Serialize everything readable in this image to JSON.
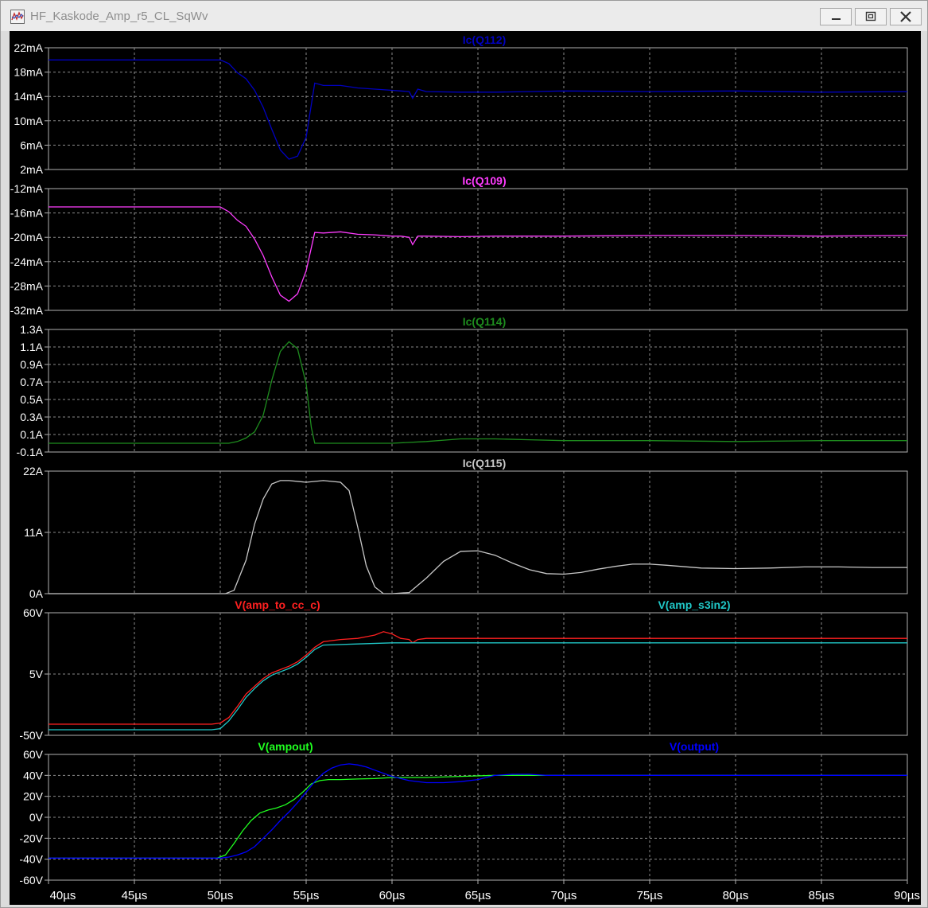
{
  "window": {
    "title": "HF_Kaskode_Amp_r5_CL_SqWv",
    "icons": [
      "waveform-app-icon",
      "minimize-icon",
      "maximize-icon",
      "close-icon"
    ]
  },
  "colors": {
    "background": "#000000",
    "grid": "#8a8a8a",
    "axis_text": "#ffffff",
    "Ic(Q112)": "#0000c0",
    "Ic(Q109)": "#ff3cff",
    "Ic(Q114)": "#1e8c1e",
    "Ic(Q115)": "#c8c8c8",
    "V(amp_to_cc_c)": "#ff2020",
    "V(amp_s3in2)": "#20c8c8",
    "V(ampout)": "#20ff20",
    "V(output)": "#0000ff"
  },
  "chart_data": [
    {
      "type": "line",
      "series": [
        {
          "name": "Ic(Q112)",
          "x": [
            40,
            50,
            50.5,
            51,
            51.5,
            52,
            52.5,
            53,
            53.5,
            54,
            54.5,
            55,
            55.5,
            56,
            57,
            58,
            59,
            60,
            60.5,
            61,
            61.2,
            61.5,
            62,
            64,
            66,
            68,
            70,
            75,
            80,
            85,
            90
          ],
          "y": [
            20,
            20,
            19.4,
            17.9,
            16.9,
            15,
            12.2,
            8.6,
            5.2,
            3.7,
            4.2,
            7.3,
            16.2,
            15.8,
            15.8,
            15.4,
            15.2,
            15,
            14.9,
            14.8,
            13.7,
            15.2,
            14.8,
            14.7,
            14.7,
            14.8,
            14.9,
            14.8,
            14.9,
            14.7,
            14.8
          ]
        }
      ],
      "y_ticks": [
        "22mA",
        "18mA",
        "14mA",
        "10mA",
        "6mA",
        "2mA"
      ],
      "ylim": [
        2,
        22
      ]
    },
    {
      "type": "line",
      "series": [
        {
          "name": "Ic(Q109)",
          "x": [
            40,
            50,
            50.5,
            51,
            51.5,
            52,
            52.5,
            53,
            53.5,
            54,
            54.5,
            55,
            55.5,
            56,
            57,
            58,
            59,
            60,
            60.5,
            61,
            61.2,
            61.5,
            62,
            64,
            66,
            68,
            70,
            75,
            80,
            85,
            90
          ],
          "y": [
            -15,
            -15,
            -15.8,
            -17.2,
            -18.2,
            -20.3,
            -23,
            -26.5,
            -29.5,
            -30.5,
            -29.3,
            -25.5,
            -19.2,
            -19.3,
            -19.1,
            -19.5,
            -19.6,
            -19.8,
            -19.8,
            -20,
            -21.2,
            -19.8,
            -19.8,
            -19.9,
            -19.8,
            -19.8,
            -19.8,
            -19.7,
            -19.7,
            -19.8,
            -19.7
          ]
        }
      ],
      "y_ticks": [
        "-12mA",
        "-16mA",
        "-20mA",
        "-24mA",
        "-28mA",
        "-32mA"
      ],
      "ylim": [
        -32,
        -12
      ]
    },
    {
      "type": "line",
      "series": [
        {
          "name": "Ic(Q114)",
          "x": [
            40,
            50,
            50.5,
            51,
            51.5,
            52,
            52.5,
            53,
            53.5,
            54,
            54.5,
            55,
            55.3,
            55.5,
            56,
            58,
            60,
            62,
            64,
            66,
            68,
            70,
            75,
            80,
            85,
            90
          ],
          "y": [
            0,
            0,
            0,
            0.02,
            0.06,
            0.13,
            0.32,
            0.72,
            1.05,
            1.16,
            1.08,
            0.68,
            0.18,
            0,
            0,
            0,
            0,
            0.02,
            0.05,
            0.05,
            0.04,
            0.03,
            0.03,
            0.02,
            0.03,
            0.03
          ]
        }
      ],
      "y_ticks": [
        "1.3A",
        "1.1A",
        "0.9A",
        "0.7A",
        "0.5A",
        "0.3A",
        "0.1A",
        "-0.1A"
      ],
      "ylim": [
        -0.1,
        1.3
      ]
    },
    {
      "type": "line",
      "series": [
        {
          "name": "Ic(Q115)",
          "x": [
            40,
            50,
            50.3,
            50.8,
            51.5,
            52,
            52.5,
            53,
            53.5,
            54,
            55,
            56,
            57,
            57.5,
            58,
            58.5,
            59,
            59.5,
            60,
            61,
            62,
            63,
            64,
            65,
            66,
            67,
            68,
            69,
            70,
            71,
            72,
            73,
            74,
            75,
            76,
            78,
            80,
            82,
            84,
            86,
            88,
            90
          ],
          "y": [
            0,
            0,
            0,
            0.6,
            6,
            12.5,
            17,
            19.7,
            20.3,
            20.3,
            20,
            20.3,
            20,
            18.5,
            12,
            5,
            1.2,
            0,
            0,
            0.2,
            2.8,
            5.8,
            7.6,
            7.7,
            6.9,
            5.5,
            4.3,
            3.6,
            3.5,
            3.8,
            4.4,
            4.9,
            5.3,
            5.3,
            5.1,
            4.6,
            4.5,
            4.6,
            4.8,
            4.8,
            4.7,
            4.7
          ]
        }
      ],
      "y_ticks": [
        "22A",
        "11A",
        "0A"
      ],
      "ylim": [
        0,
        22
      ]
    },
    {
      "type": "line",
      "series": [
        {
          "name": "V(amp_to_cc_c)",
          "x": [
            40,
            49.5,
            50,
            50.5,
            51,
            51.5,
            52,
            52.5,
            53,
            53.5,
            54,
            54.5,
            55,
            55.5,
            56,
            57,
            58,
            58.5,
            59,
            59.5,
            60,
            60.5,
            61,
            61.2,
            61.5,
            62,
            64,
            66,
            70,
            75,
            80,
            85,
            90
          ],
          "y": [
            -40,
            -40,
            -39,
            -34,
            -24,
            -13,
            -6,
            1,
            6,
            9,
            12,
            16,
            22,
            29,
            34,
            36,
            37,
            38.5,
            40,
            43,
            41,
            37,
            36,
            33,
            36,
            37,
            37,
            37,
            37,
            37,
            37,
            37,
            37
          ]
        },
        {
          "name": "V(amp_s3in2)",
          "x": [
            40,
            49.5,
            50,
            50.5,
            51,
            51.5,
            52,
            52.5,
            53,
            53.5,
            54,
            54.5,
            55,
            55.5,
            56,
            58,
            60,
            61,
            62,
            64,
            66,
            70,
            75,
            80,
            85,
            90
          ],
          "y": [
            -45,
            -45,
            -44,
            -37,
            -27,
            -16,
            -8,
            -1,
            4,
            7,
            10,
            14,
            20,
            27,
            31,
            32,
            33,
            33,
            33,
            33,
            33,
            33,
            33,
            33,
            33,
            33
          ]
        }
      ],
      "y_ticks": [
        "60V",
        "5V",
        "-50V"
      ],
      "ylim": [
        -50,
        60
      ]
    },
    {
      "type": "line",
      "series": [
        {
          "name": "V(ampout)",
          "x": [
            40,
            49.8,
            50.3,
            50.8,
            51.3,
            51.8,
            52.3,
            52.8,
            53.3,
            53.8,
            54.3,
            54.8,
            55.3,
            55.8,
            56.3,
            57,
            58,
            59,
            60,
            61,
            62,
            64,
            66,
            70,
            75,
            80,
            85,
            90
          ],
          "y": [
            -39,
            -39,
            -36,
            -25,
            -13,
            -3,
            4,
            7,
            9,
            12,
            17,
            24,
            32,
            35,
            36,
            36,
            36.5,
            37,
            38,
            38,
            38,
            39,
            40,
            40,
            40,
            40,
            40,
            40
          ]
        },
        {
          "name": "V(output)",
          "x": [
            40,
            50,
            50.5,
            51,
            51.5,
            52,
            52.5,
            53,
            53.5,
            54,
            54.5,
            55,
            55.5,
            56,
            56.5,
            57,
            57.5,
            58,
            58.5,
            59,
            59.5,
            60,
            60.5,
            61,
            62,
            63,
            64,
            65,
            66,
            67,
            68,
            69,
            70,
            72,
            75,
            80,
            85,
            90
          ],
          "y": [
            -39,
            -39,
            -38,
            -36,
            -33,
            -28,
            -20,
            -12,
            -3,
            5,
            14,
            24,
            34,
            42,
            47,
            50,
            51,
            50,
            48,
            45,
            42,
            39,
            37,
            35,
            33,
            33,
            34,
            36,
            40,
            41,
            41,
            40,
            40,
            40,
            40,
            40,
            40,
            40
          ]
        }
      ],
      "y_ticks": [
        "60V",
        "40V",
        "20V",
        "0V",
        "-20V",
        "-40V",
        "-60V"
      ],
      "ylim": [
        -60,
        60
      ]
    }
  ],
  "x_axis": {
    "unit": "µs",
    "xlim": [
      40,
      90
    ],
    "tick_labels": [
      "40µs",
      "45µs",
      "50µs",
      "55µs",
      "60µs",
      "65µs",
      "70µs",
      "75µs",
      "80µs",
      "85µs",
      "90µs"
    ]
  }
}
